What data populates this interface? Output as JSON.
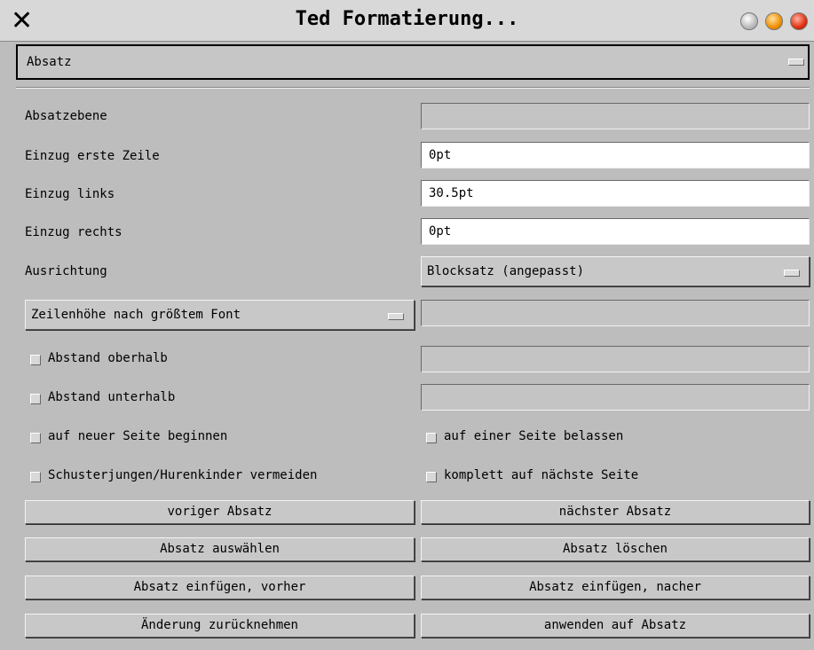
{
  "window": {
    "title": "Ted Formatierung...",
    "close_icon": "x-icon",
    "controls": [
      "grey-button",
      "orange-button",
      "red-button"
    ]
  },
  "page_selector": {
    "value": "Absatz"
  },
  "fields": {
    "absatzebene": {
      "label": "Absatzebene",
      "value": ""
    },
    "einzug_erste": {
      "label": "Einzug erste Zeile",
      "value": "0pt"
    },
    "einzug_links": {
      "label": "Einzug links",
      "value": "30.5pt"
    },
    "einzug_rechts": {
      "label": "Einzug rechts",
      "value": "0pt"
    },
    "ausrichtung": {
      "label": "Ausrichtung",
      "value": "Blocksatz (angepasst)"
    },
    "zeilenhoehe": {
      "value": "Zeilenhöhe nach größtem Font",
      "input": ""
    },
    "abstand_oberhalb": {
      "label": "Abstand oberhalb",
      "value": ""
    },
    "abstand_unterhalb": {
      "label": "Abstand unterhalb",
      "value": ""
    }
  },
  "checkboxes": {
    "neue_seite": "auf neuer Seite beginnen",
    "einer_seite": "auf einer Seite belassen",
    "schusterjungen": "Schusterjungen/Hurenkinder vermeiden",
    "komplett": "komplett auf nächste Seite"
  },
  "buttons": {
    "voriger": "voriger Absatz",
    "naechster": "nächster Absatz",
    "auswaehlen": "Absatz auswählen",
    "loeschen": "Absatz löschen",
    "einfuegen_vorher": "Absatz einfügen, vorher",
    "einfuegen_nachher": "Absatz einfügen, nacher",
    "zuruecknehmen": "Änderung zurücknehmen",
    "anwenden": "anwenden auf Absatz"
  }
}
